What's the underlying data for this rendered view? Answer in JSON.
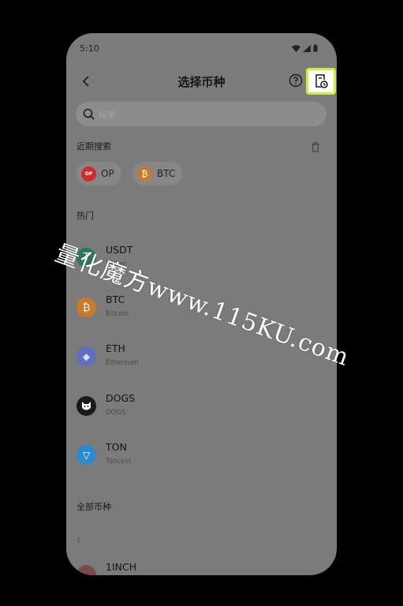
{
  "status": {
    "time": "5:10"
  },
  "header": {
    "title": "选择币种"
  },
  "search": {
    "placeholder": "搜索"
  },
  "recent": {
    "title": "近期搜索",
    "items": [
      {
        "label": "OP",
        "color": "#d12b2b",
        "icon_text": "OP"
      },
      {
        "label": "BTC",
        "color": "#c97a2a",
        "icon_text": "₿"
      }
    ]
  },
  "hot": {
    "title": "热门",
    "coins": [
      {
        "symbol": "USDT",
        "name": "Tether",
        "color": "#2a7a5a",
        "icon_text": "₮"
      },
      {
        "symbol": "BTC",
        "name": "Bitcoin",
        "color": "#c97a2a",
        "icon_text": "₿"
      },
      {
        "symbol": "ETH",
        "name": "Ethereum",
        "color": "#5f6fc0",
        "icon_text": "◆"
      },
      {
        "symbol": "DOGS",
        "name": "DOGS",
        "color": "#1a1a1a",
        "icon_text": "🐶"
      },
      {
        "symbol": "TON",
        "name": "Toncoin",
        "color": "#2b8acb",
        "icon_text": "▽"
      }
    ]
  },
  "all": {
    "title": "全部币种",
    "index_letter": "1",
    "coins": [
      {
        "symbol": "1INCH",
        "color": "#7a4a4a",
        "icon_text": ""
      }
    ]
  },
  "watermark": {
    "text": "量化魔方www.115KU.com"
  },
  "colors": {
    "highlight": "#c8f23a"
  }
}
